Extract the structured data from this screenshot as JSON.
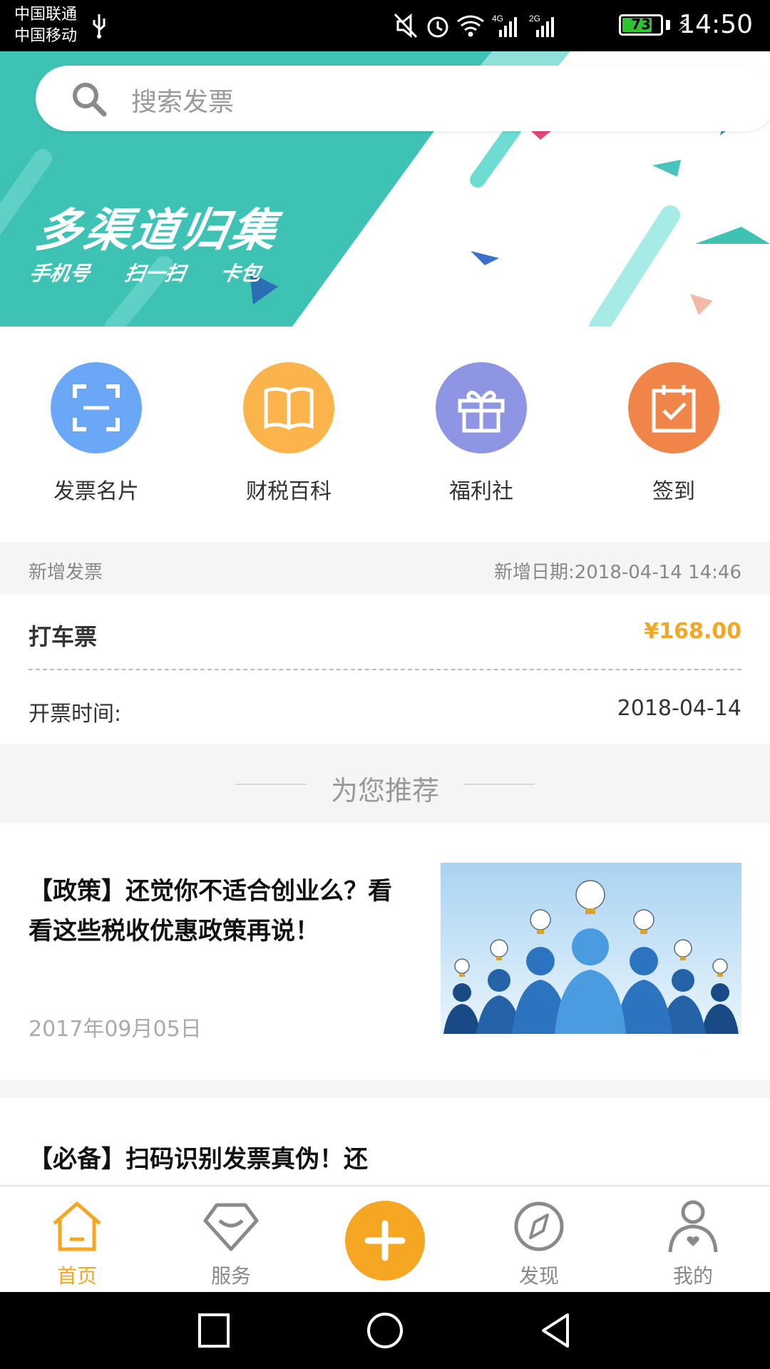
{
  "status_bar": {
    "carrier_1": "中国联通",
    "carrier_2": "中国移动",
    "network_1": "4G",
    "network_2": "2G",
    "battery_level": "73",
    "time": "14:50"
  },
  "banner": {
    "search_placeholder": "搜索发票",
    "title": "多渠道归集",
    "subtitles": [
      "手机号",
      "扫一扫",
      "卡包"
    ],
    "colors": {
      "teal": "#3ec2b4",
      "light_teal": "#8ee0d8"
    }
  },
  "quick_actions": [
    {
      "label": "发票名片",
      "icon": "scan-frame-icon",
      "color": "#6aa8f7"
    },
    {
      "label": "财税百科",
      "icon": "open-book-icon",
      "color": "#fbb34b"
    },
    {
      "label": "福利社",
      "icon": "gift-icon",
      "color": "#8e95e3"
    },
    {
      "label": "签到",
      "icon": "calendar-check-icon",
      "color": "#f0854a"
    }
  ],
  "new_invoice": {
    "header_label": "新增发票",
    "added_date": "新增日期:2018-04-14 14:46",
    "type": "打车票",
    "amount": "¥168.00",
    "issue_label": "开票时间:",
    "issue_date": "2018-04-14",
    "amount_color": "#f5a623"
  },
  "recommend": {
    "title": "为您推荐"
  },
  "articles": [
    {
      "title": "【政策】还觉你不适合创业么？看看这些税收优惠政策再说！",
      "date": "2017年09月05日",
      "image": "lightbulb-people-image"
    },
    {
      "title": "【必备】扫码识别发票真伪！还"
    }
  ],
  "bottom_nav": {
    "items": [
      {
        "label": "首页",
        "icon": "home-icon",
        "active": true
      },
      {
        "label": "服务",
        "icon": "diamond-icon",
        "active": false
      },
      {
        "label": "",
        "icon": "add-icon",
        "active": false
      },
      {
        "label": "发现",
        "icon": "compass-icon",
        "active": false
      },
      {
        "label": "我的",
        "icon": "person-icon",
        "active": false
      }
    ],
    "active_color": "#f5a623"
  }
}
